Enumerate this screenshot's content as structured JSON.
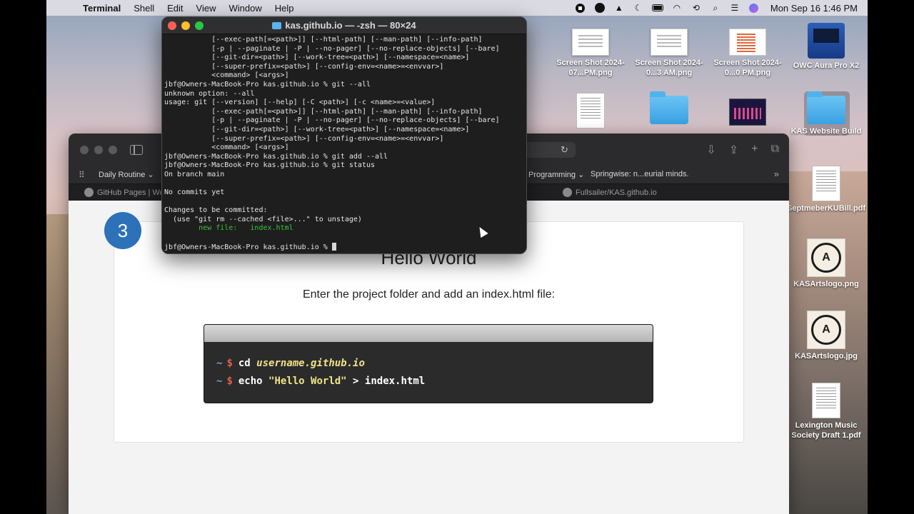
{
  "menubar": {
    "app_name": "Terminal",
    "menus": [
      "Shell",
      "Edit",
      "View",
      "Window",
      "Help"
    ],
    "clock": "Mon Sep 16  1:46 PM"
  },
  "desktop": {
    "icons": [
      {
        "label": "Screen Shot 2024-07...PM.png"
      },
      {
        "label": "Screen Shot 2024-0...3 AM.png"
      },
      {
        "label": "Screen Shot 2024-0...0 PM.png"
      },
      {
        "label": "OWC Aura Pro X2"
      },
      {
        "label": "KAS Website Build"
      },
      {
        "label": "SeptmeberKUBill.pdf"
      },
      {
        "label": "KASArtslogo.png"
      },
      {
        "label": "KASArtslogo.jpg"
      },
      {
        "label": "Lexington Music Society Draft 1.pdf"
      }
    ]
  },
  "browser": {
    "bookmarks": [
      "Daily Routine",
      "Programming",
      "Springwise: n...eurial minds."
    ],
    "tabs": [
      "GitHub Pages | Wel",
      "Fullsailer/KAS.github.io"
    ],
    "content": {
      "step_number": "3",
      "heading": "Hello World",
      "instruction": "Enter the project folder and add an index.html file:",
      "code": {
        "prompt_tilde": "~",
        "prompt_dollar": "$",
        "line1_cmd": "cd",
        "line1_arg": "username.github.io",
        "line2_cmd": "echo",
        "line2_str": "\"Hello World\"",
        "line2_rest": "> index.html"
      }
    }
  },
  "terminal": {
    "title": "kas.github.io — -zsh — 80×24",
    "lines": [
      "           [--exec-path[=<path>]] [--html-path] [--man-path] [--info-path]",
      "           [-p | --paginate | -P | --no-pager] [--no-replace-objects] [--bare]",
      "           [--git-dir=<path>] [--work-tree=<path>] [--namespace=<name>]",
      "           [--super-prefix=<path>] [--config-env=<name>=<envvar>]",
      "           <command> [<args>]",
      "jbf@Owners-MacBook-Pro kas.github.io % git --all",
      "unknown option: --all",
      "usage: git [--version] [--help] [-C <path>] [-c <name>=<value>]",
      "           [--exec-path[=<path>]] [--html-path] [--man-path] [--info-path]",
      "           [-p | --paginate | -P | --no-pager] [--no-replace-objects] [--bare]",
      "           [--git-dir=<path>] [--work-tree=<path>] [--namespace=<name>]",
      "           [--super-prefix=<path>] [--config-env=<name>=<envvar>]",
      "           <command> [<args>]",
      "jbf@Owners-MacBook-Pro kas.github.io % git add --all",
      "jbf@Owners-MacBook-Pro kas.github.io % git status",
      "On branch main",
      "",
      "No commits yet",
      "",
      "Changes to be committed:",
      "  (use \"git rm --cached <file>...\" to unstage)",
      "        new file:   index.html",
      "",
      "jbf@Owners-MacBook-Pro kas.github.io % "
    ],
    "green_line_index": 21
  },
  "colors": {
    "close": "#ff5f57",
    "minimize": "#febc2e",
    "zoom": "#28c840",
    "step_blue": "#2d72b8",
    "terminal_green": "#38c438"
  }
}
